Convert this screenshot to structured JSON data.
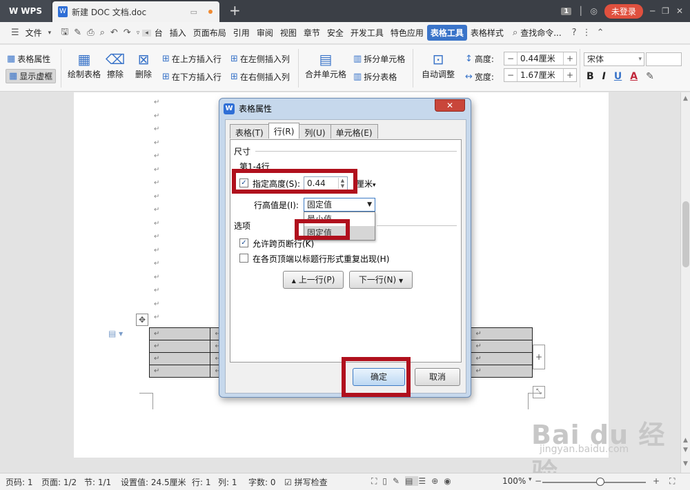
{
  "titlebar": {
    "app": "WPS",
    "doc_tab": "新建 DOC 文档.doc",
    "new_tab": "+",
    "page_badge": "1",
    "login": "未登录"
  },
  "menubar": {
    "file": "文件",
    "items": [
      "台",
      "插入",
      "页面布局",
      "引用",
      "审阅",
      "视图",
      "章节",
      "安全",
      "开发工具",
      "特色应用",
      "表格工具",
      "表格样式"
    ],
    "active": "表格工具",
    "search": "查找命令..."
  },
  "ribbon": {
    "table_props": "表格属性",
    "show_grid": "显示虚框",
    "draw_table": "绘制表格",
    "erase": "擦除",
    "delete": "删除",
    "insert_above": "在上方插入行",
    "insert_below": "在下方插入行",
    "insert_left": "在左侧插入列",
    "insert_right": "在右侧插入列",
    "merge_cells": "合并单元格",
    "split_cells": "拆分单元格",
    "split_table": "拆分表格",
    "auto_fit": "自动调整",
    "height_label": "高度:",
    "height_value": "0.44厘米",
    "width_label": "宽度:",
    "width_value": "1.67厘米",
    "font_name": "宋体",
    "bold": "B",
    "italic": "I",
    "underline": "U",
    "font_color": "A"
  },
  "document": {
    "para_mark": "↵"
  },
  "dialog": {
    "title": "表格属性",
    "close": "✕",
    "tabs": [
      "表格(T)",
      "行(R)",
      "列(U)",
      "单元格(E)"
    ],
    "selected_tab": "行(R)",
    "section_size": "尺寸",
    "rows_label": "第1-4行",
    "specify_height": "指定高度(S):",
    "specify_height_checked": true,
    "height_value": "0.44",
    "unit": "厘米",
    "row_height_is": "行高值是(I):",
    "row_height_value": "固定值",
    "dropdown_options": [
      "最小值",
      "固定值"
    ],
    "section_options": "选项",
    "allow_break": "允许跨页断行(K)",
    "allow_break_checked": true,
    "repeat_header": "在各页顶端以标题行形式重复出现(H)",
    "repeat_header_checked": false,
    "prev_row": "上一行(P)",
    "next_row": "下一行(N)",
    "ok": "确定",
    "cancel": "取消"
  },
  "statusbar": {
    "page": "页码: 1",
    "pages": "页面: 1/2",
    "section": "节: 1/1",
    "setting": "设置值: 24.5厘米",
    "row": "行: 1",
    "col": "列: 1",
    "words": "字数: 0",
    "spellcheck": "拼写检查",
    "zoom": "100%"
  },
  "watermark": {
    "logo": "Bai du 经验",
    "url": "jingyan.baidu.com"
  }
}
